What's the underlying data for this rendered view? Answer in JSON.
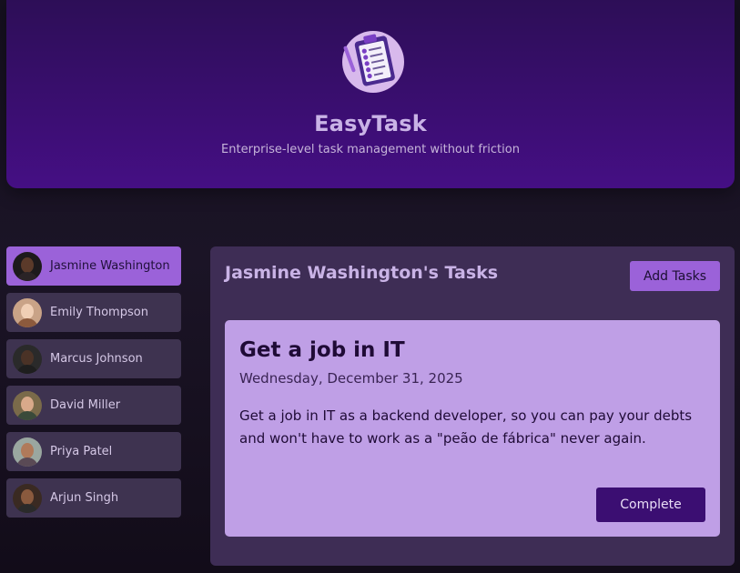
{
  "header": {
    "logo_icon": "clipboard-checklist-icon",
    "title": "EasyTask",
    "subtitle": "Enterprise-level task management without friction"
  },
  "sidebar": {
    "items": [
      {
        "name": "Jasmine Washington",
        "active": true,
        "avatar_icon": "user-avatar-icon"
      },
      {
        "name": "Emily Thompson",
        "active": false,
        "avatar_icon": "user-avatar-icon"
      },
      {
        "name": "Marcus Johnson",
        "active": false,
        "avatar_icon": "user-avatar-icon"
      },
      {
        "name": "David Miller",
        "active": false,
        "avatar_icon": "user-avatar-icon"
      },
      {
        "name": "Priya Patel",
        "active": false,
        "avatar_icon": "user-avatar-icon"
      },
      {
        "name": "Arjun Singh",
        "active": false,
        "avatar_icon": "user-avatar-icon"
      }
    ]
  },
  "main": {
    "title": "Jasmine Washington's Tasks",
    "add_button_label": "Add Tasks",
    "tasks": [
      {
        "title": "Get a job in IT",
        "date": "Wednesday, December 31, 2025",
        "description": "Get a job in IT as a backend developer, so you can pay your debts and won't have to work as a \"peão de fábrica\" never again.",
        "complete_label": "Complete"
      }
    ]
  },
  "colors": {
    "header_bg": "#3b0e72",
    "accent": "#9b62d9",
    "card_bg": "#bf9fe6",
    "panel_bg": "#3e2d55",
    "sidebar_item_bg": "#3e3350",
    "button_dark": "#3b0e72"
  }
}
